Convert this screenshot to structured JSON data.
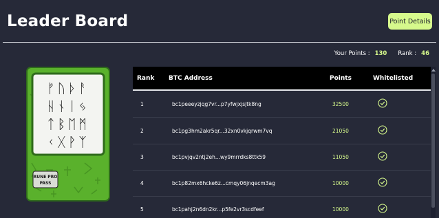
{
  "header": {
    "title": "Leader Board",
    "point_details_label": "Point Details"
  },
  "stats": {
    "points_label": "Your Points :",
    "points_value": "130",
    "rank_label": "Rank :",
    "rank_value": "46"
  },
  "card": {
    "runes_row1": "ᚠᚢᚦᚨ",
    "runes_row2": "ᚺᚾᛁᛃ",
    "runes_row3": "ᛏᛒᛖᛗ",
    "runes_row4": "ᚲᚷᚹᛉ",
    "logo_text_line1": "RUNE PRO",
    "logo_text_line2": "PASS",
    "colors": {
      "green": "#5ab12c",
      "frame": "#2f6a1c",
      "panel": "#f3f4f1"
    }
  },
  "table": {
    "headers": [
      "Rank",
      "BTC Address",
      "Points",
      "Whitelisted"
    ],
    "rows": [
      {
        "rank": "1",
        "address": "bc1peeeyzjqg7vr...p7yfwjxjsjtk8ng",
        "points": "32500",
        "whitelisted": "check-circle-icon"
      },
      {
        "rank": "2",
        "address": "bc1pg3hm2akr5qr...32xn0vkjqrwm7vq",
        "points": "21050",
        "whitelisted": "check-circle-icon"
      },
      {
        "rank": "3",
        "address": "bc1pvjqv2ntj2eh...wy9mrrdks8ttk59",
        "points": "11050",
        "whitelisted": "check-circle-icon"
      },
      {
        "rank": "4",
        "address": "bc1p82mx6hcke6z...cmqy06jnqecm3ag",
        "points": "10000",
        "whitelisted": "check-circle-icon"
      },
      {
        "rank": "5",
        "address": "bc1pahj2n6dn2kr...p5fe2vr3scdfeef",
        "points": "10000",
        "whitelisted": "check-circle-icon"
      }
    ]
  },
  "colors": {
    "accent": "#d6f98c",
    "background": "#262938",
    "table_header": "#000000"
  }
}
